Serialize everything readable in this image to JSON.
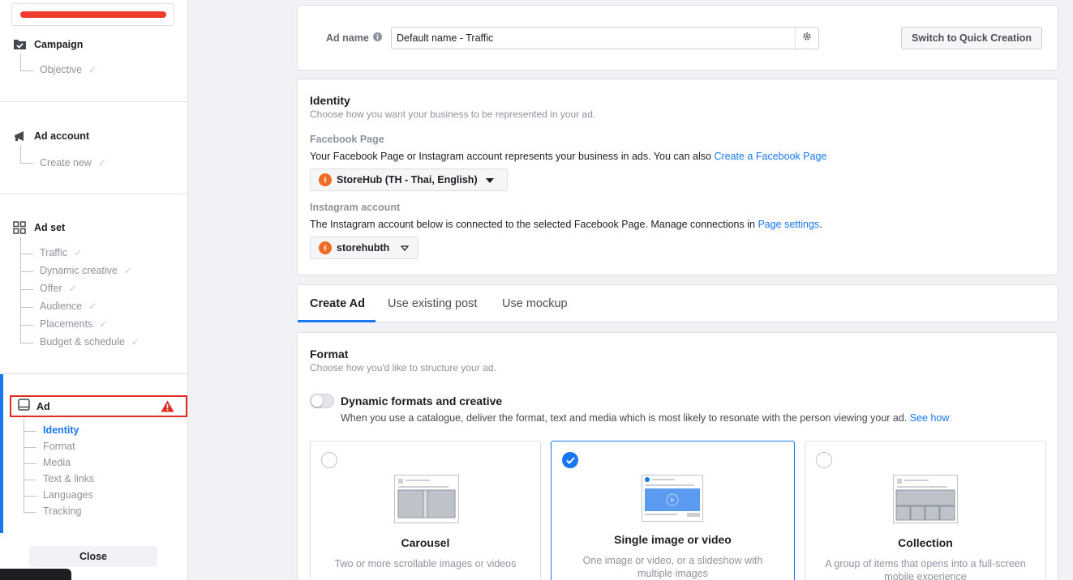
{
  "sidebar": {
    "campaign": {
      "label": "Campaign",
      "items": [
        {
          "label": "Objective"
        }
      ]
    },
    "ad_account": {
      "label": "Ad account",
      "items": [
        {
          "label": "Create new"
        }
      ]
    },
    "ad_set": {
      "label": "Ad set",
      "items": [
        {
          "label": "Traffic"
        },
        {
          "label": "Dynamic creative"
        },
        {
          "label": "Offer"
        },
        {
          "label": "Audience"
        },
        {
          "label": "Placements"
        },
        {
          "label": "Budget & schedule"
        }
      ]
    },
    "ad": {
      "label": "Ad",
      "items": [
        {
          "label": "Identity",
          "active": true
        },
        {
          "label": "Format"
        },
        {
          "label": "Media"
        },
        {
          "label": "Text & links"
        },
        {
          "label": "Languages"
        },
        {
          "label": "Tracking"
        }
      ]
    },
    "close_label": "Close"
  },
  "ad_name": {
    "label": "Ad name",
    "value": "Default name - Traffic",
    "quick_creation_label": "Switch to Quick Creation"
  },
  "identity": {
    "title": "Identity",
    "subtitle": "Choose how you want your business to be represented in your ad.",
    "facebook_page": {
      "label": "Facebook Page",
      "description": "Your Facebook Page or Instagram account represents your business in ads. You can also ",
      "link": "Create a Facebook Page",
      "selected": "StoreHub (TH - Thai, English)"
    },
    "instagram": {
      "label": "Instagram account",
      "description": "The Instagram account below is connected to the selected Facebook Page. Manage connections in ",
      "link": "Page settings",
      "suffix": ".",
      "selected": "storehubth"
    }
  },
  "tabs": [
    {
      "label": "Create Ad",
      "active": true
    },
    {
      "label": "Use existing post"
    },
    {
      "label": "Use mockup"
    }
  ],
  "format": {
    "title": "Format",
    "subtitle": "Choose how you'd like to structure your ad.",
    "dynamic": {
      "label": "Dynamic formats and creative",
      "description": "When you use a catalogue, deliver the format, text and media which is most likely to resonate with the person viewing your ad. ",
      "link": "See how",
      "enabled": false
    },
    "options": [
      {
        "title": "Carousel",
        "description": "Two or more scrollable images or videos",
        "selected": false
      },
      {
        "title": "Single image or video",
        "description": "One image or video, or a slideshow with multiple images",
        "selected": true
      },
      {
        "title": "Collection",
        "description": "A group of items that opens into a full-screen mobile experience",
        "selected": false
      }
    ]
  },
  "colors": {
    "accent": "#1877f2",
    "warning": "#e02b20",
    "avatar": "#f06b22"
  }
}
